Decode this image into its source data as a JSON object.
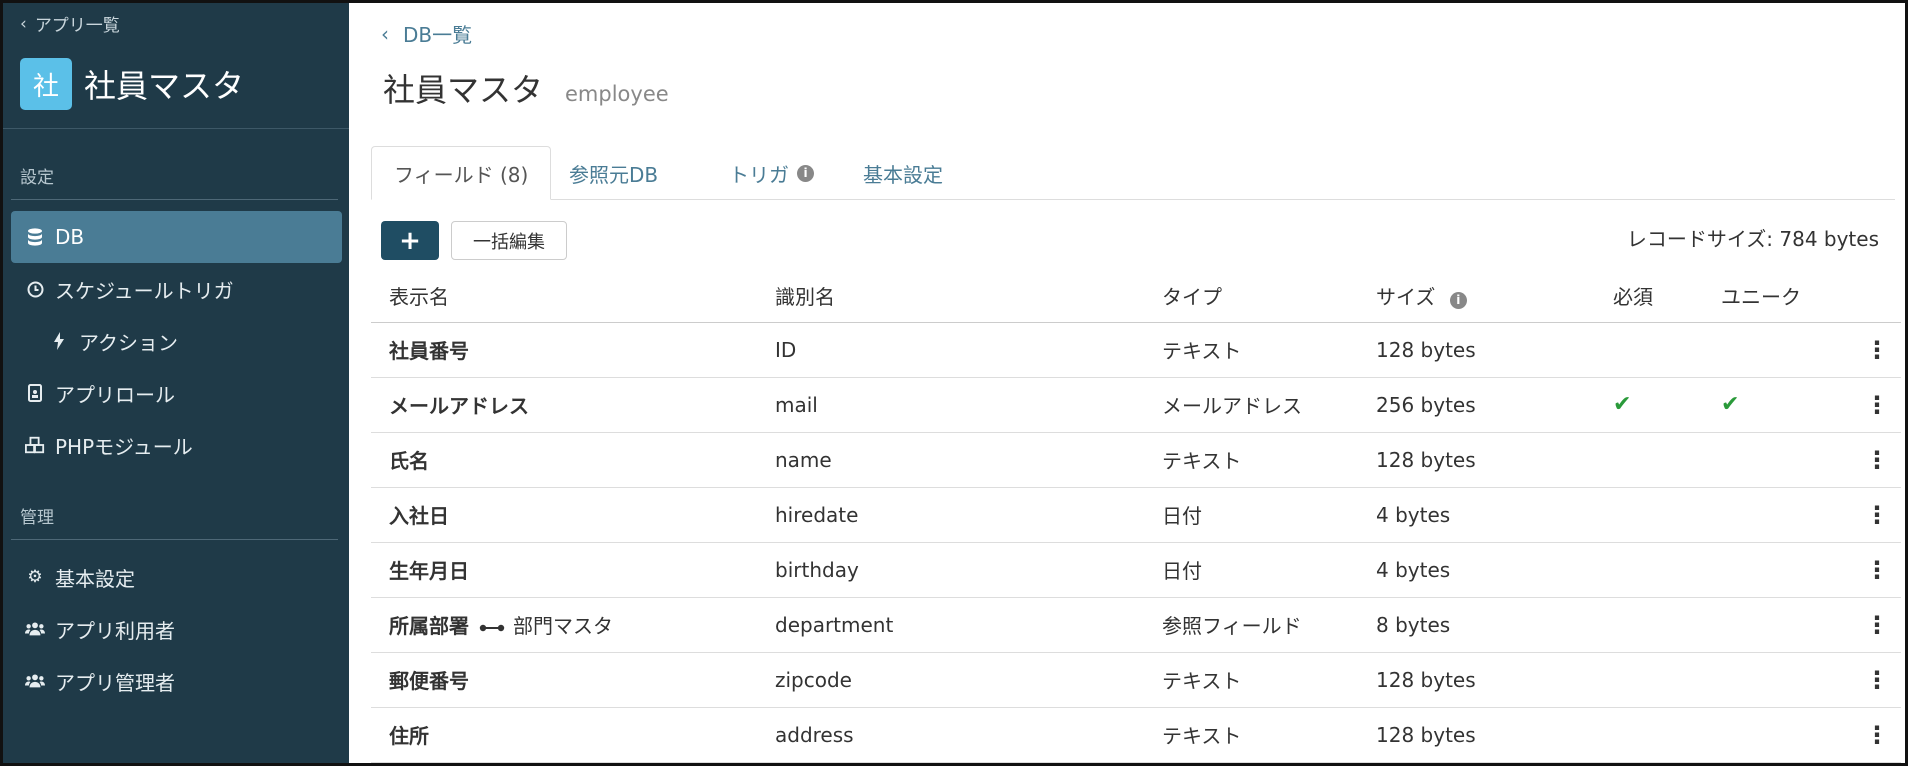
{
  "sidebar": {
    "back_label": "アプリ一覧",
    "app_icon_char": "社",
    "app_name": "社員マスタ",
    "section_settings": "設定",
    "section_admin": "管理",
    "items": [
      {
        "label": "DB",
        "icon": "database-icon"
      },
      {
        "label": "スケジュールトリガ",
        "icon": "clock-icon"
      },
      {
        "label": "アクション",
        "icon": "bolt-icon"
      },
      {
        "label": "アプリロール",
        "icon": "id-badge-icon"
      },
      {
        "label": "PHPモジュール",
        "icon": "cubes-icon"
      },
      {
        "label": "基本設定",
        "icon": "gear-icon"
      },
      {
        "label": "アプリ利用者",
        "icon": "users-icon"
      },
      {
        "label": "アプリ管理者",
        "icon": "users-icon"
      }
    ]
  },
  "main": {
    "breadcrumb": "DB一覧",
    "title": "社員マスタ",
    "subtitle": "employee",
    "tabs": [
      {
        "label": "フィールド (8)"
      },
      {
        "label": "参照元DB"
      },
      {
        "label": "トリガ"
      },
      {
        "label": "基本設定"
      }
    ],
    "add_button": "+",
    "bulk_edit_button": "一括編集",
    "record_size": "レコードサイズ: 784 bytes"
  },
  "table": {
    "headers": [
      "表示名",
      "識別名",
      "タイプ",
      "サイズ",
      "必須",
      "ユニーク"
    ],
    "rows": [
      {
        "display": "社員番号",
        "ref": "",
        "id": "ID",
        "type": "テキスト",
        "size": "128 bytes",
        "required": false,
        "unique": false
      },
      {
        "display": "メールアドレス",
        "ref": "",
        "id": "mail",
        "type": "メールアドレス",
        "size": "256 bytes",
        "required": true,
        "unique": true
      },
      {
        "display": "氏名",
        "ref": "",
        "id": "name",
        "type": "テキスト",
        "size": "128 bytes",
        "required": false,
        "unique": false
      },
      {
        "display": "入社日",
        "ref": "",
        "id": "hiredate",
        "type": "日付",
        "size": "4 bytes",
        "required": false,
        "unique": false
      },
      {
        "display": "生年月日",
        "ref": "",
        "id": "birthday",
        "type": "日付",
        "size": "4 bytes",
        "required": false,
        "unique": false
      },
      {
        "display": "所属部署",
        "ref": "部門マスタ",
        "id": "department",
        "type": "参照フィールド",
        "size": "8 bytes",
        "required": false,
        "unique": false
      },
      {
        "display": "郵便番号",
        "ref": "",
        "id": "zipcode",
        "type": "テキスト",
        "size": "128 bytes",
        "required": false,
        "unique": false
      },
      {
        "display": "住所",
        "ref": "",
        "id": "address",
        "type": "テキスト",
        "size": "128 bytes",
        "required": false,
        "unique": false
      }
    ]
  },
  "colors": {
    "sidebar_bg": "#1f3a48",
    "active_item": "#4a7c95",
    "accent": "#4a7c95",
    "app_icon": "#5bc0e8",
    "check": "#2a9a3a"
  }
}
